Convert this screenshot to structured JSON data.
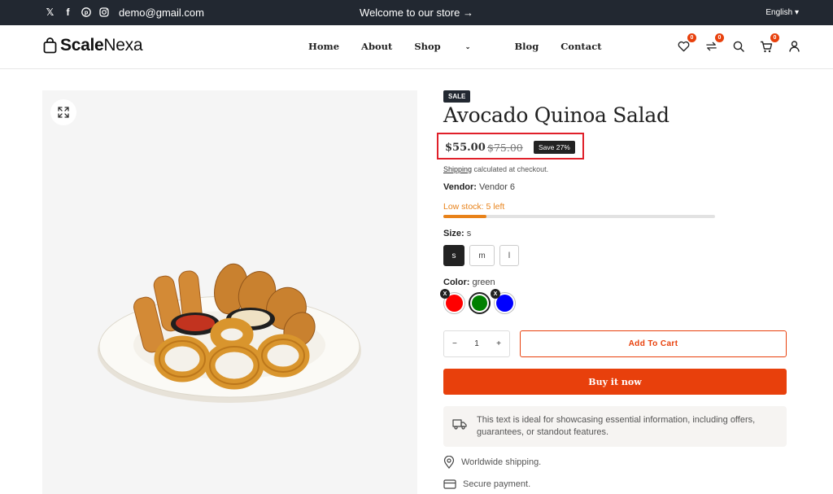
{
  "topbar": {
    "social": [
      "x-icon",
      "facebook-icon",
      "pinterest-icon",
      "instagram-icon"
    ],
    "email": "demo@gmail.com",
    "welcome": "Welcome to our store",
    "language": "English"
  },
  "header": {
    "logo_bold": "Scale",
    "logo_light": "Nexa",
    "nav": [
      "Home",
      "About",
      "Shop",
      "Blog",
      "Contact"
    ],
    "wishlist_count": "0",
    "compare_count": "0",
    "cart_count": "0"
  },
  "product": {
    "badge": "SALE",
    "title": "Avocado Quinoa Salad",
    "price": "$55.00",
    "compare_price": "$75.00",
    "save_label": "Save 27%",
    "shipping_link": "Shipping",
    "shipping_text": " calculated at checkout.",
    "vendor_label": "Vendor:",
    "vendor_value": " Vendor 6",
    "stock_text": "Low stock: 5 left",
    "stock_level": 0.16,
    "size_label": "Size:",
    "size_value": " s",
    "sizes": [
      "s",
      "m",
      "l"
    ],
    "color_label": "Color:",
    "color_value": " green",
    "colors": [
      {
        "name": "red",
        "hex": "#ff0000"
      },
      {
        "name": "green",
        "hex": "#008000"
      },
      {
        "name": "blue",
        "hex": "#0000ff"
      }
    ],
    "swatch_x": "X",
    "quantity": "1",
    "qty_minus": "−",
    "qty_plus": "+",
    "add_to_cart": "Add To Cart",
    "buy_now": "Buy it now",
    "notice": "This text is ideal for showcasing essential information, including offers, guarantees, or standout features.",
    "feature_shipping": "Worldwide shipping.",
    "feature_payment": "Secure payment."
  },
  "colors": {
    "accent": "#e8400c",
    "dark": "#222831",
    "stock": "#e8821a",
    "highlight": "#e0202a"
  }
}
